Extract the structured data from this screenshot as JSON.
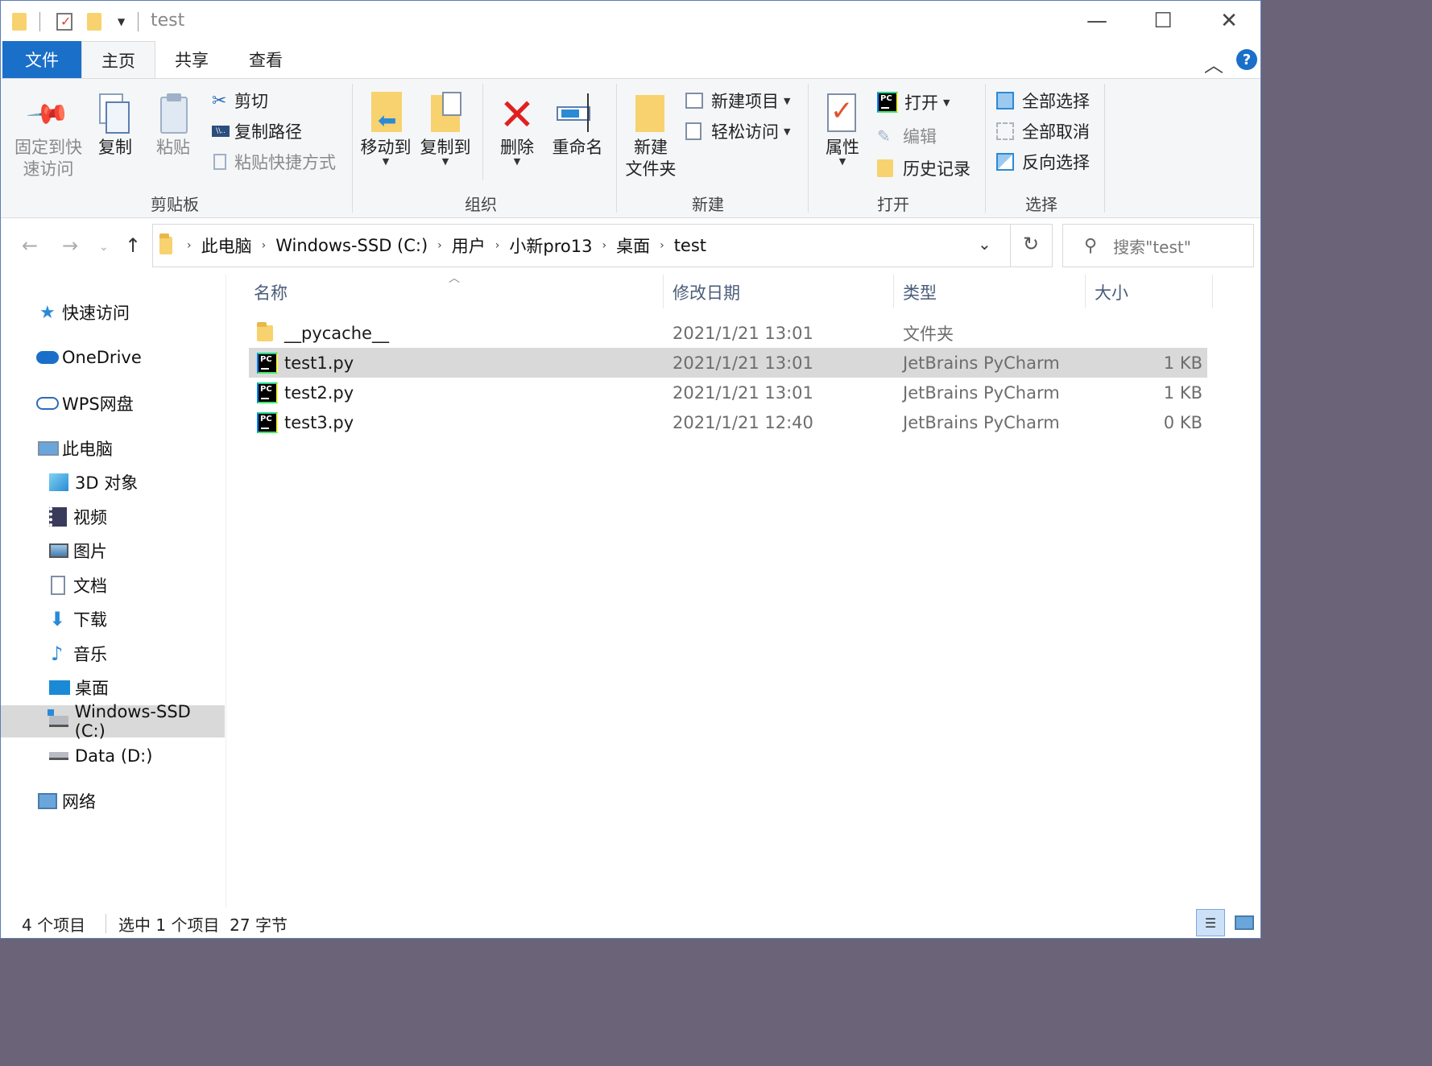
{
  "window": {
    "title": "test",
    "minimize": "—",
    "maximize": "☐",
    "close": "✕"
  },
  "tabs": {
    "file": "文件",
    "home": "主页",
    "share": "共享",
    "view": "查看"
  },
  "ribbon": {
    "clipboard": {
      "pin": [
        "固定到快",
        "速访问"
      ],
      "copy": "复制",
      "paste": "粘贴",
      "cut": "剪切",
      "copy_path": "复制路径",
      "paste_shortcut": "粘贴快捷方式",
      "label": "剪贴板"
    },
    "organize": {
      "move_to": "移动到",
      "copy_to": "复制到",
      "delete": "删除",
      "rename": "重命名",
      "label": "组织"
    },
    "new": {
      "new_folder": [
        "新建",
        "文件夹"
      ],
      "new_item": "新建项目",
      "easy_access": "轻松访问",
      "label": "新建"
    },
    "open": {
      "properties": "属性",
      "open": "打开",
      "edit": "编辑",
      "history": "历史记录",
      "label": "打开"
    },
    "select": {
      "select_all": "全部选择",
      "select_none": "全部取消",
      "invert": "反向选择",
      "label": "选择"
    }
  },
  "address": {
    "crumbs": [
      "此电脑",
      "Windows-SSD (C:)",
      "用户",
      "小新pro13",
      "桌面",
      "test"
    ],
    "search_placeholder": "搜索\"test\""
  },
  "nav": {
    "items": [
      {
        "label": "快速访问",
        "icon": "star-icon"
      },
      {
        "label": "OneDrive",
        "icon": "cloud-icon"
      },
      {
        "label": "WPS网盘",
        "icon": "cloud-outline-icon"
      },
      {
        "label": "此电脑",
        "icon": "computer-icon"
      },
      {
        "label": "3D 对象",
        "icon": "cube-icon"
      },
      {
        "label": "视频",
        "icon": "film-icon"
      },
      {
        "label": "图片",
        "icon": "picture-icon"
      },
      {
        "label": "文档",
        "icon": "document-icon"
      },
      {
        "label": "下载",
        "icon": "download-arrow-icon"
      },
      {
        "label": "音乐",
        "icon": "music-note-icon"
      },
      {
        "label": "桌面",
        "icon": "desktop-icon"
      },
      {
        "label": "Windows-SSD (C:)",
        "icon": "system-drive-icon"
      },
      {
        "label": "Data (D:)",
        "icon": "drive-icon"
      },
      {
        "label": "网络",
        "icon": "network-icon"
      }
    ]
  },
  "list": {
    "headers": {
      "name": "名称",
      "modified": "修改日期",
      "type": "类型",
      "size": "大小"
    },
    "rows": [
      {
        "name": "__pycache__",
        "modified": "2021/1/21 13:01",
        "type": "文件夹",
        "size": "",
        "icon": "folder-icon"
      },
      {
        "name": "test1.py",
        "modified": "2021/1/21 13:01",
        "type": "JetBrains PyCharm",
        "size": "1 KB",
        "icon": "pycharm-file-icon"
      },
      {
        "name": "test2.py",
        "modified": "2021/1/21 13:01",
        "type": "JetBrains PyCharm",
        "size": "1 KB",
        "icon": "pycharm-file-icon"
      },
      {
        "name": "test3.py",
        "modified": "2021/1/21 12:40",
        "type": "JetBrains PyCharm",
        "size": "0 KB",
        "icon": "pycharm-file-icon"
      }
    ]
  },
  "status": {
    "count": "4 个项目",
    "selection": "选中 1 个项目  27 字节"
  },
  "colors": {
    "accent": "#1a6fc9",
    "selection": "#d9d9d9",
    "ribbon_bg": "#f5f6f7"
  }
}
